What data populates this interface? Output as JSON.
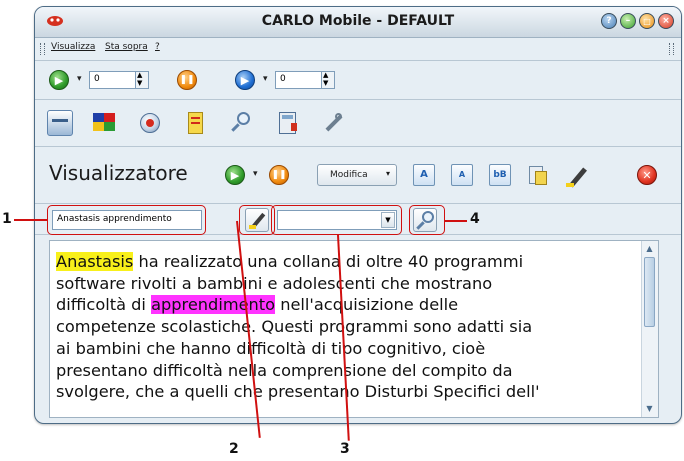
{
  "window": {
    "title": "CARLO Mobile - DEFAULT"
  },
  "menu": {
    "items": [
      "Visualizza",
      "Sta sopra",
      "?"
    ]
  },
  "player_row": {
    "spin1_value": "0",
    "spin2_value": "0"
  },
  "viewer": {
    "title": "Visualizzatore",
    "modifica_label": "Modifica",
    "btn_bigger": "A",
    "btn_smaller": "A",
    "btn_case": "bB"
  },
  "search": {
    "input_value": "Anastasis apprendimento",
    "combo_value": ""
  },
  "document": {
    "lines": [
      [
        "Anastasis",
        " ha realizzato una collana di oltre 40 programmi"
      ],
      [
        "software rivolti a bambini e adolescenti che mostrano"
      ],
      [
        "difficoltà di ",
        "apprendimento",
        " nell'acquisizione delle"
      ],
      [
        "competenze scolastiche. Questi programmi sono adatti sia"
      ],
      [
        "ai bambini che hanno difficoltà di tipo cognitivo, cioè"
      ],
      [
        "presentano difficoltà nella comprensione del compito da"
      ],
      [
        "svolgere, che a quelli che presentano Disturbi Specifici dell'"
      ]
    ]
  },
  "callouts": {
    "c1": "1",
    "c2": "2",
    "c3": "3",
    "c4": "4"
  },
  "colors": {
    "highlight_yellow": "#f8f01a",
    "highlight_magenta": "#ff33ff",
    "callout_red": "#d01010"
  }
}
